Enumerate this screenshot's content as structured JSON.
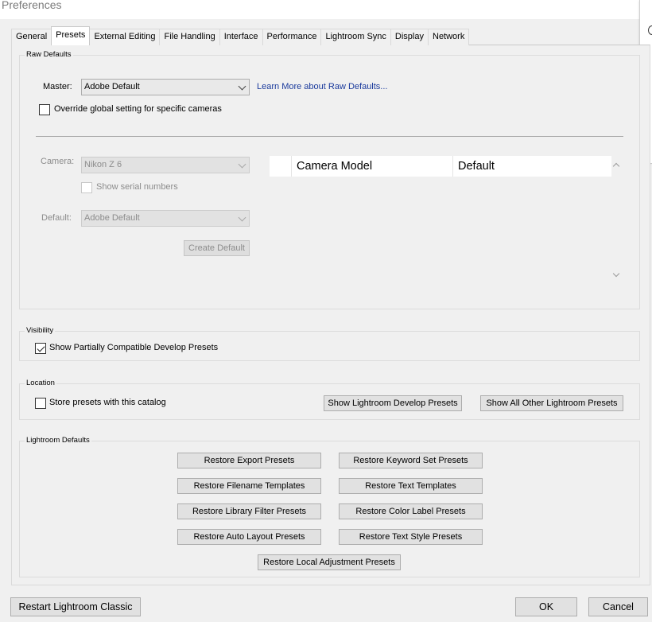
{
  "window": {
    "title": "Preferences"
  },
  "tabs": [
    "General",
    "Presets",
    "External Editing",
    "File Handling",
    "Interface",
    "Performance",
    "Lightroom Sync",
    "Display",
    "Network"
  ],
  "raw_defaults": {
    "group_label": "Raw Defaults",
    "master_label": "Master:",
    "master_value": "Adobe Default",
    "learn_more": "Learn More about Raw Defaults...",
    "override_label": "Override global setting for specific cameras",
    "override_checked": false,
    "camera_label": "Camera:",
    "camera_value": "Nikon Z 6",
    "show_serial_label": "Show serial numbers",
    "default_label": "Default:",
    "default_value": "Adobe Default",
    "create_default": "Create Default",
    "table_headers": [
      "Camera Model",
      "Default"
    ]
  },
  "visibility": {
    "group_label": "Visibility",
    "show_partial_label": "Show Partially Compatible Develop Presets",
    "show_partial_checked": true
  },
  "location": {
    "group_label": "Location",
    "store_label": "Store presets with this catalog",
    "store_checked": false,
    "show_develop": "Show Lightroom Develop Presets",
    "show_other": "Show All Other Lightroom Presets"
  },
  "lightroom_defaults": {
    "group_label": "Lightroom Defaults",
    "buttons": [
      "Restore Export Presets",
      "Restore Keyword Set Presets",
      "Restore Filename Templates",
      "Restore Text Templates",
      "Restore Library Filter Presets",
      "Restore Color Label Presets",
      "Restore Auto Layout Presets",
      "Restore Text Style Presets",
      "Restore Local Adjustment Presets"
    ]
  },
  "footer": {
    "restart": "Restart Lightroom Classic",
    "ok": "OK",
    "cancel": "Cancel"
  }
}
